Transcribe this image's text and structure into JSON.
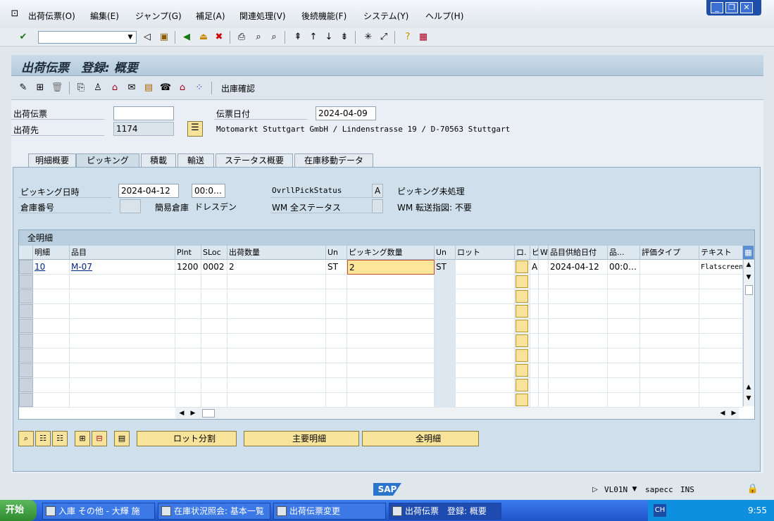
{
  "menu": [
    "出荷伝票(O)",
    "編集(E)",
    "ジャンプ(G)",
    "補足(A)",
    "関連処理(V)",
    "後続機能(F)",
    "システム(Y)",
    "ヘルプ(H)"
  ],
  "title": "出荷伝票　登録: 概要",
  "appbar": {
    "confirm_label": "出庫確認"
  },
  "header": {
    "delivery_label": "出荷伝票",
    "delivery_value": "",
    "shipto_label": "出荷先",
    "shipto_value": "1174",
    "date_label": "伝票日付",
    "date_value": "2024-04-09",
    "address": "Motomarkt Stuttgart GmbH / Lindenstrasse 19 / D-70563 Stuttgart"
  },
  "tabs": [
    "明細概要",
    "ピッキング",
    "積載",
    "輸送",
    "ステータス概要",
    "在庫移動データ"
  ],
  "picking": {
    "date_label": "ピッキング日時",
    "date_value": "2024-04-12",
    "time_value": "00:0…",
    "status_label": "OvrllPickStatus",
    "status_value": "A",
    "status_text": "ピッキング未処理",
    "warehouse_label": "倉庫番号",
    "warehouse_value": "",
    "simple_wh_label": "簡易倉庫",
    "simple_wh_value": "ドレスデン",
    "wm_status_label": "WM 全ステータス",
    "wm_status_value": "",
    "wm_transfer_text": "WM 転送指図: 不要"
  },
  "table": {
    "title": "全明細",
    "columns": [
      "明細",
      "品目",
      "Plnt",
      "SLoc",
      "出荷数量",
      "Un",
      "ピッキング数量",
      "Un",
      "ロット",
      "ロ.",
      "ピ",
      "W.",
      "品目供給日付",
      "品...",
      "評価タイプ",
      "テキスト"
    ],
    "rows": [
      [
        "10",
        "M-07",
        "1200",
        "0002",
        "2",
        "ST",
        "2",
        "ST",
        "",
        "",
        "A",
        "",
        "2024-04-12",
        "00:0…",
        "",
        "Flatscreen"
      ]
    ]
  },
  "buttons": {
    "batch_split": "ロット分割",
    "main_items": "主要明細",
    "all_items": "全明細"
  },
  "status": {
    "tcode": "VL01N",
    "system": "sapecc",
    "mode": "INS",
    "time": "9:55"
  },
  "taskbar": {
    "start": "开始",
    "tasks": [
      "入庫 その他 - 大輝 施",
      "在庫状況照会: 基本一覧",
      "出荷伝票変更",
      "出荷伝票　登録: 概要"
    ]
  }
}
